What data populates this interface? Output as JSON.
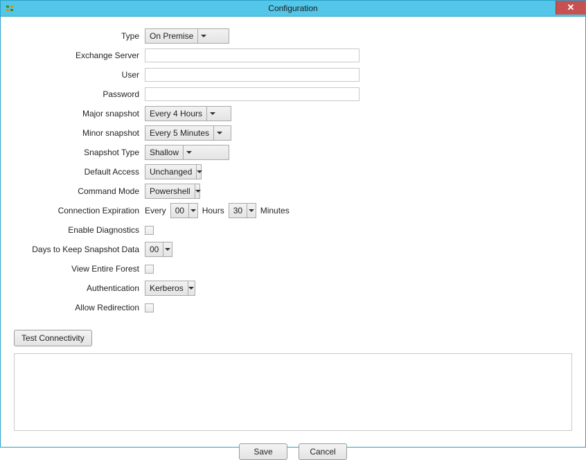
{
  "window": {
    "title": "Configuration",
    "close_glyph": "✕"
  },
  "labels": {
    "type": "Type",
    "exchange": "Exchange Server",
    "user": "User",
    "password": "Password",
    "major": "Major snapshot",
    "minor": "Minor snapshot",
    "snaptype": "Snapshot Type",
    "access": "Default Access",
    "cmd": "Command Mode",
    "connexp": "Connection Expiration",
    "diag": "Enable Diagnostics",
    "days": "Days to Keep Snapshot Data",
    "forest": "View Entire Forest",
    "auth": "Authentication",
    "redir": "Allow Redirection"
  },
  "values": {
    "type": "On Premise",
    "exchange": "",
    "user": "",
    "password": "",
    "major": "Every 4 Hours",
    "minor": "Every 5 Minutes",
    "snaptype": "Shallow",
    "access": "Unchanged",
    "cmd": "Powershell",
    "conn_every": "Every",
    "conn_hours_val": "00",
    "conn_hours_lbl": "Hours",
    "conn_min_val": "30",
    "conn_min_lbl": "Minutes",
    "days": "00",
    "auth": "Kerberos"
  },
  "buttons": {
    "test": "Test Connectivity",
    "save": "Save",
    "cancel": "Cancel"
  }
}
